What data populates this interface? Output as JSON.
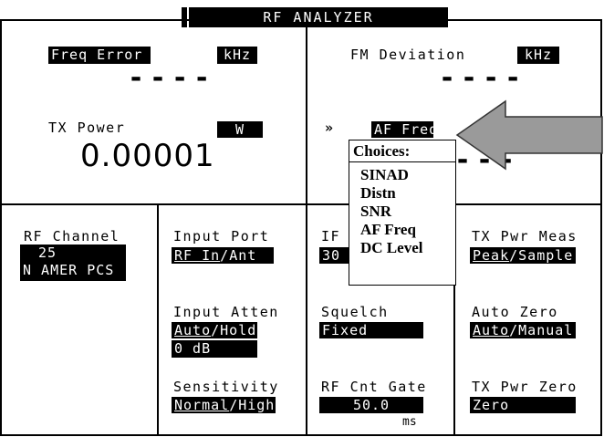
{
  "title": "RF ANALYZER",
  "top_left": {
    "freq_error": {
      "label": "Freq Error",
      "unit": "kHz",
      "value": "----"
    },
    "tx_power": {
      "label": "TX Power",
      "unit": "W",
      "value": "0.00001"
    }
  },
  "top_right": {
    "fm_deviation": {
      "label": "FM Deviation",
      "unit": "kHz",
      "value": "----"
    },
    "af_freq": {
      "marker": "»",
      "label": "AF Freq",
      "value": "---"
    }
  },
  "choices": {
    "header": "Choices:",
    "options": [
      "SINAD",
      "Distn",
      "SNR",
      "AF Freq",
      "DC Level"
    ]
  },
  "col1": {
    "rf_channel": {
      "label": "RF Channel",
      "value": "25",
      "band": "N AMER PCS"
    }
  },
  "col2": {
    "input_port": {
      "label": "Input Port",
      "opt1": "RF In",
      "sep": "/",
      "opt2": "Ant"
    },
    "input_atten": {
      "label": "Input Atten",
      "opt1": "Auto",
      "sep": "/",
      "opt2": "Hold",
      "value": "0 dB"
    },
    "sensitivity": {
      "label": "Sensitivity",
      "opt1": "Normal",
      "sep": "/",
      "opt2": "High"
    }
  },
  "col3": {
    "if_filter": {
      "label": "IF",
      "value": "30"
    },
    "squelch": {
      "label": "Squelch",
      "value": "Fixed"
    },
    "rf_cnt_gate": {
      "label": "RF Cnt Gate",
      "value": "50.0",
      "unit": "ms"
    }
  },
  "col4": {
    "tx_pwr_meas": {
      "label": "TX Pwr Meas",
      "opt1": "Peak",
      "sep": "/",
      "opt2": "Sample"
    },
    "auto_zero": {
      "label": "Auto Zero",
      "opt1": "Auto",
      "sep": "/",
      "opt2": "Manual"
    },
    "tx_pwr_zero": {
      "label": "TX Pwr Zero",
      "value": "Zero"
    }
  }
}
